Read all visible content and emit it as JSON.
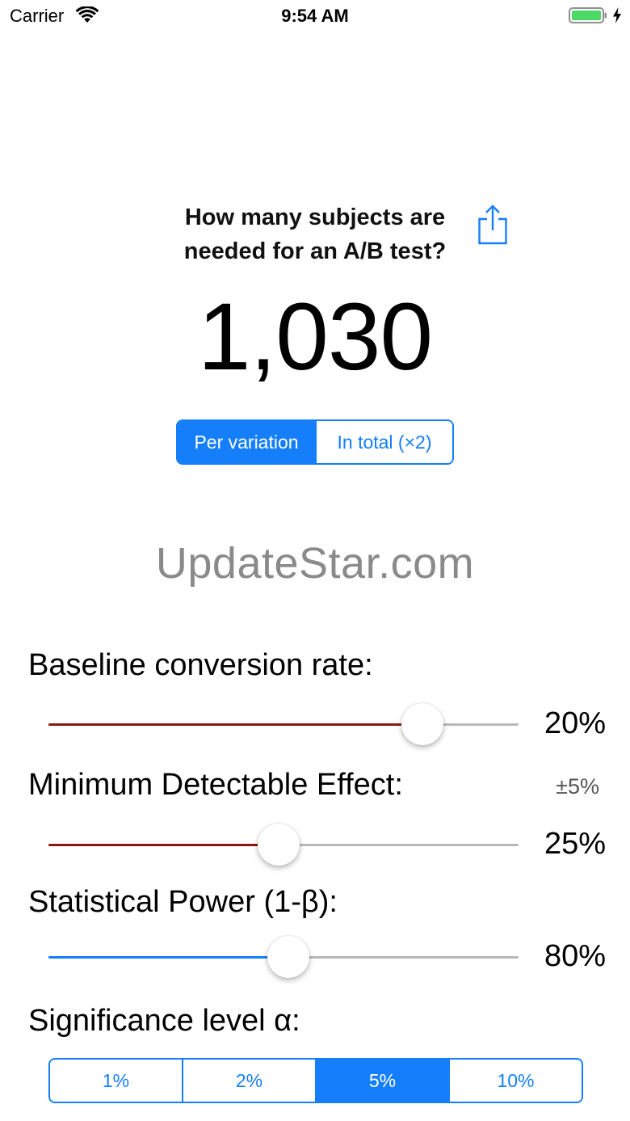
{
  "status_bar": {
    "carrier": "Carrier",
    "time": "9:54 AM",
    "icons": [
      "wifi-icon",
      "battery-icon",
      "charging-icon"
    ],
    "battery_color": "#4CD964"
  },
  "header": {
    "question": "How many subjects are needed for an A/B test?",
    "share_icon": "share-icon"
  },
  "result": {
    "value": "1,030"
  },
  "mode_selector": {
    "options": [
      "Per variation",
      "In total (×2)"
    ],
    "selected": "Per variation"
  },
  "watermark": "UpdateStar.com",
  "parameters": {
    "baseline": {
      "label": "Baseline conversion rate:",
      "value_text": "20%",
      "slider_fraction": 0.795,
      "fill_color": "#8B1A0E"
    },
    "mde": {
      "label": "Minimum Detectable Effect:",
      "note": "±5%",
      "value_text": "25%",
      "slider_fraction": 0.49,
      "fill_color": "#8B1A0E"
    },
    "power": {
      "label": "Statistical Power (1-β):",
      "value_text": "80%",
      "slider_fraction": 0.51,
      "fill_color": "#147EFB"
    },
    "significance": {
      "label": "Significance level α:",
      "options": [
        "1%",
        "2%",
        "5%",
        "10%"
      ],
      "selected": "5%"
    }
  },
  "colors": {
    "accent": "#147EFB",
    "track": "#B8B8B8"
  }
}
